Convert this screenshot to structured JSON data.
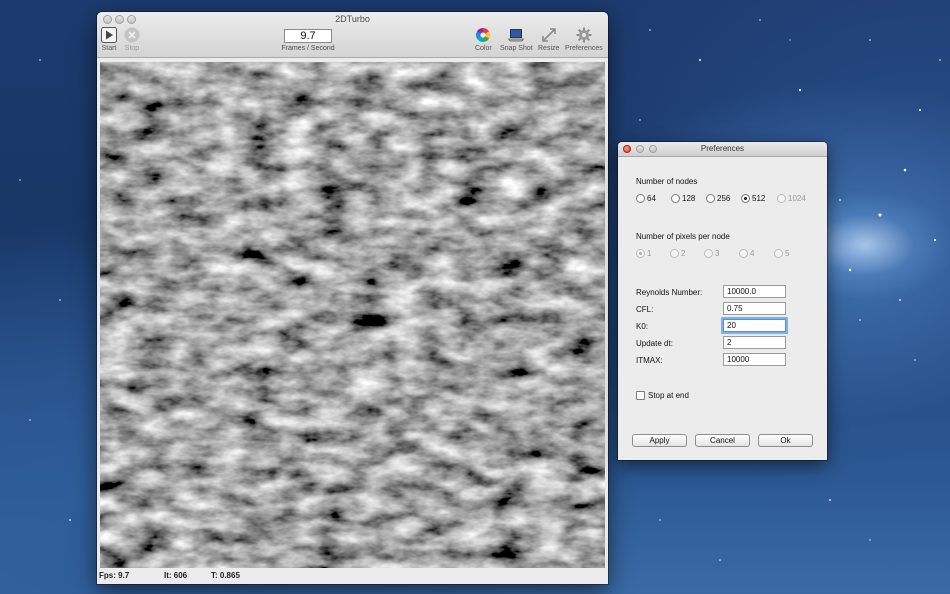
{
  "main_window": {
    "title": "2DTurbo",
    "toolbar": {
      "start_label": "Start",
      "stop_label": "Stop",
      "fps_value": "9.7",
      "fps_caption": "Frames / Second",
      "color_label": "Color",
      "snapshot_label": "Snap Shot",
      "resize_label": "Resize",
      "preferences_label": "Preferences"
    },
    "status": {
      "fps": "Fps: 9.7",
      "iteration": "It: 606",
      "time": "T: 0.865"
    }
  },
  "preferences": {
    "title": "Preferences",
    "nodes_heading": "Number of nodes",
    "nodes_options": [
      "64",
      "128",
      "256",
      "512",
      "1024"
    ],
    "nodes_selected": "512",
    "pixels_heading": "Number of pixels per node",
    "pixels_options": [
      "1",
      "2",
      "3",
      "4",
      "5"
    ],
    "pixels_selected": "1",
    "fields": {
      "reynolds_label": "Reynolds Number:",
      "reynolds_value": "10000.0",
      "cfl_label": "CFL:",
      "cfl_value": "0.75",
      "k0_label": "K0:",
      "k0_value": "20",
      "update_dt_label": "Update dt:",
      "update_dt_value": "2",
      "itmax_label": "ITMAX:",
      "itmax_value": "10000"
    },
    "stop_at_end_label": "Stop at end",
    "apply_label": "Apply",
    "cancel_label": "Cancel",
    "ok_label": "Ok"
  }
}
